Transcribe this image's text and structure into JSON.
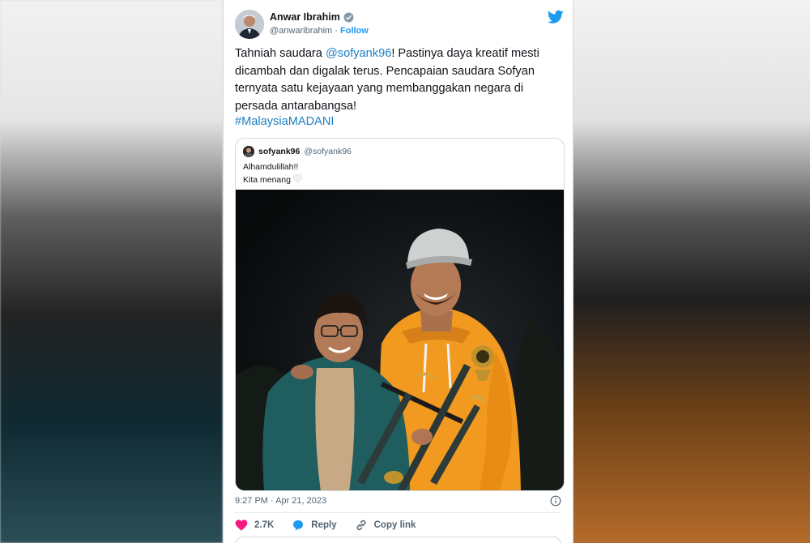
{
  "tweet": {
    "author_name": "Anwar Ibrahim",
    "author_handle": "@anwaribrahim",
    "handle_separator": "·",
    "follow_label": "Follow",
    "text_before_mention": "Tahniah saudara ",
    "mention": "@sofyank96",
    "text_after_mention": "! Pastinya daya kreatif mesti dicambah dan digalak terus. Pencapaian saudara Sofyan ternyata satu kejayaan yang membanggakan negara di persada antarabangsa!",
    "hashtag": "#MalaysiaMADANI",
    "timestamp": "9:27 PM · Apr 21, 2023"
  },
  "quoted_tweet": {
    "author_name": "sofyank96",
    "author_handle": "@sofyank96",
    "line1": "Alhamdulillah!!",
    "line2": "Kita menang"
  },
  "actions": {
    "like_count": "2.7K",
    "reply_label": "Reply",
    "copy_link_label": "Copy link"
  },
  "colors": {
    "accent": "#1d9bf0",
    "like": "#f91880",
    "text": "#0f1419",
    "muted": "#536471"
  },
  "icons": [
    "verified-badge-icon",
    "twitter-bird-icon",
    "info-icon",
    "heart-icon",
    "reply-icon",
    "link-icon"
  ]
}
